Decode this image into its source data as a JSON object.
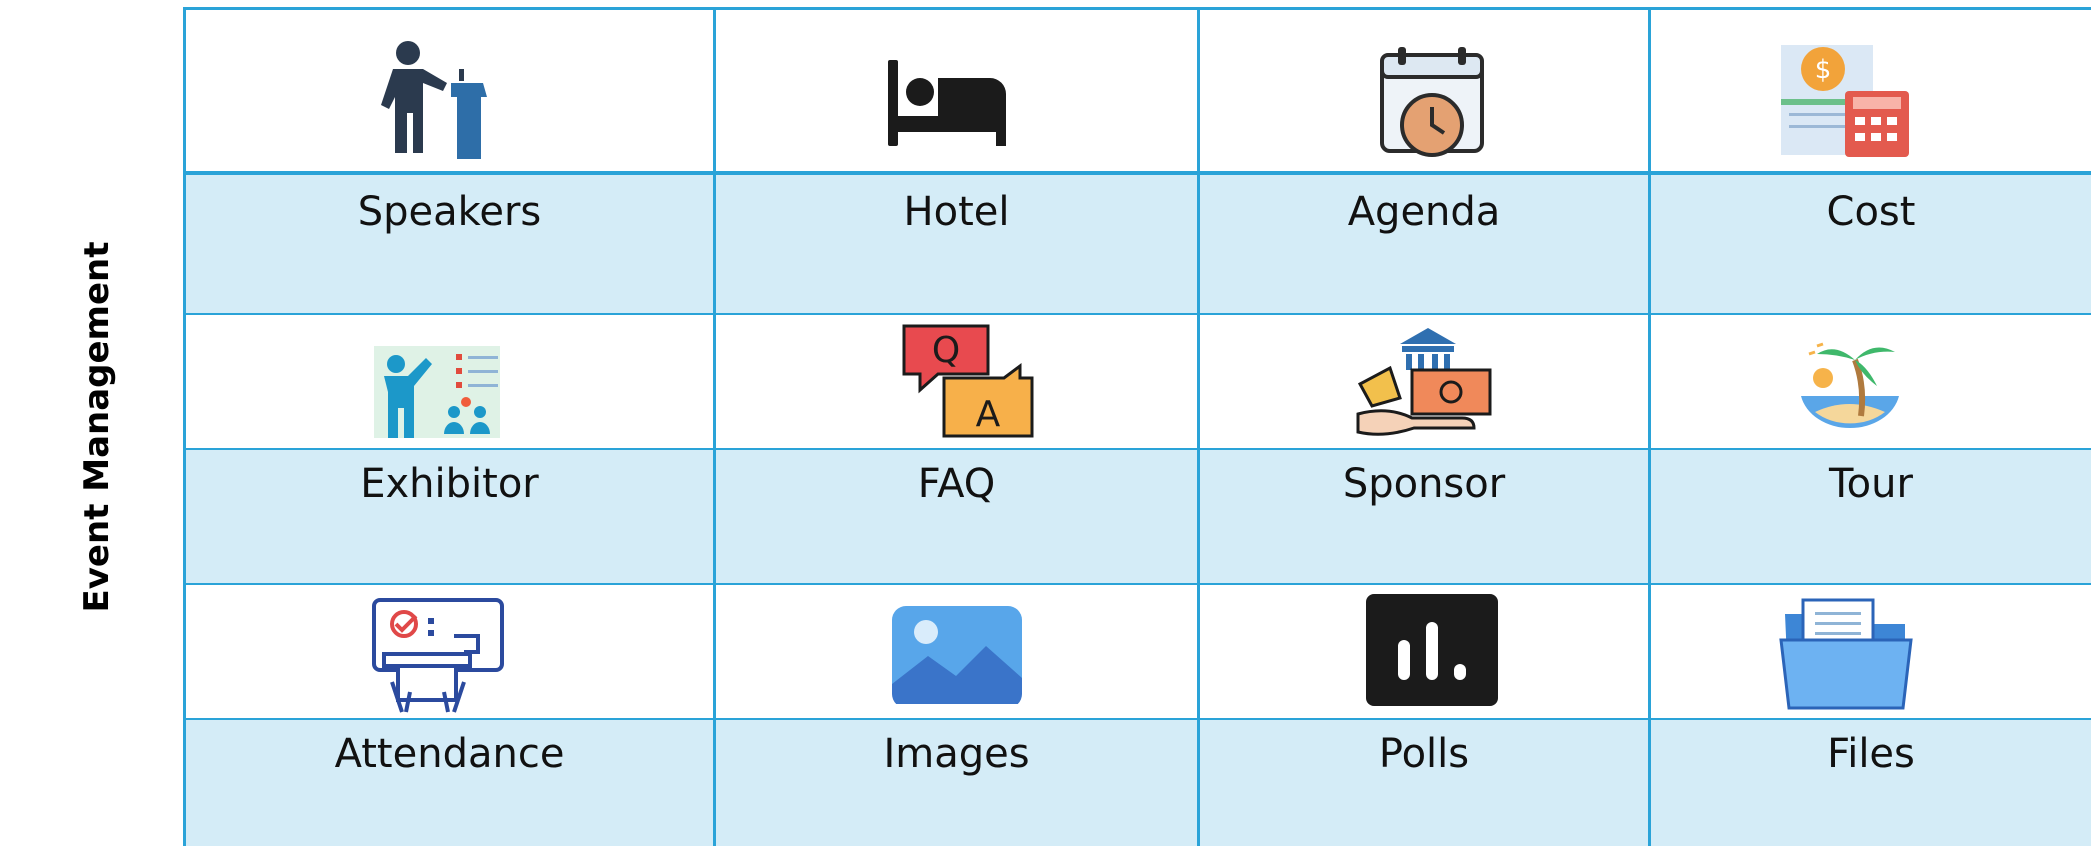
{
  "sidebar": {
    "title": "Event Management"
  },
  "tiles": [
    {
      "label": "Speakers",
      "icon": "speaker-podium-icon"
    },
    {
      "label": "Hotel",
      "icon": "hotel-bed-icon"
    },
    {
      "label": "Agenda",
      "icon": "calendar-clock-icon"
    },
    {
      "label": "Cost",
      "icon": "cost-calculator-icon"
    },
    {
      "label": "Exhibitor",
      "icon": "exhibitor-presentation-icon"
    },
    {
      "label": "FAQ",
      "icon": "faq-chat-icon"
    },
    {
      "label": "Sponsor",
      "icon": "sponsor-money-icon"
    },
    {
      "label": "Tour",
      "icon": "tour-beach-icon"
    },
    {
      "label": "Attendance",
      "icon": "attendance-checklist-icon"
    },
    {
      "label": "Images",
      "icon": "images-icon"
    },
    {
      "label": "Polls",
      "icon": "polls-chart-icon"
    },
    {
      "label": "Files",
      "icon": "files-folder-icon"
    }
  ],
  "colors": {
    "grid_line": "#2aa3d8",
    "label_row_bg": "#d4ecf7",
    "icon_row_bg": "#ffffff"
  },
  "icon_texts": {
    "faq_q": "Q",
    "faq_a": "A",
    "cost_symbol": "$"
  }
}
